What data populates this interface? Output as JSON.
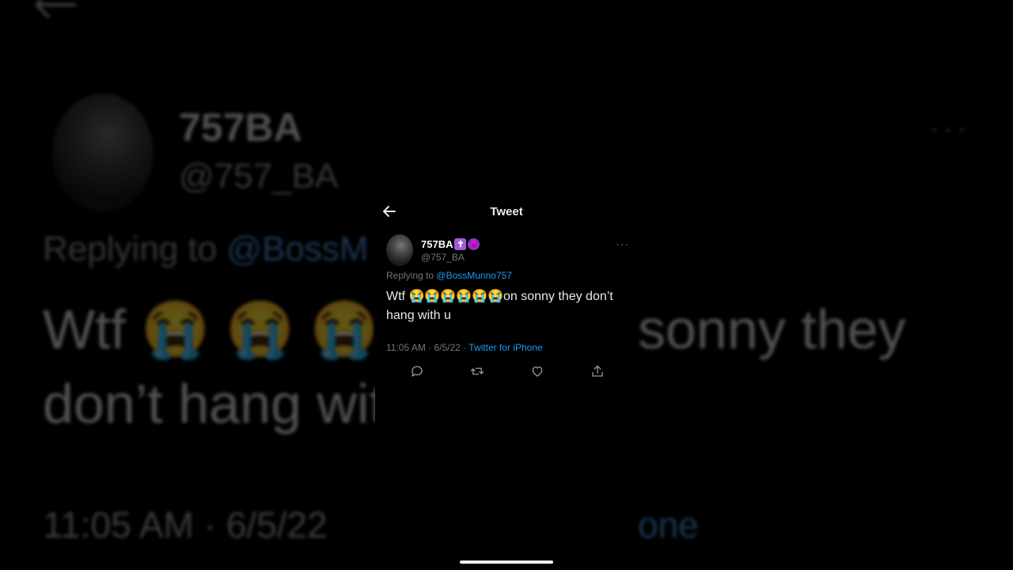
{
  "header": {
    "title": "Tweet"
  },
  "tweet": {
    "author_name": "757BA",
    "author_badges": [
      "✝",
      "😈"
    ],
    "handle": "@757_BA",
    "replying_prefix": "Replying to",
    "replying_to": "@BossMunno757",
    "text": "Wtf 😭😭😭😭😭😭on sonny they don’t hang with u",
    "timestamp": "11:05 AM · 6/5/22 · ",
    "source": "Twitter for iPhone"
  },
  "actions": [
    "reply-icon",
    "retweet-icon",
    "like-icon",
    "share-icon"
  ],
  "background_blur": {
    "name": "757BA",
    "handle": "@757_BA",
    "replying_prefix": "Replying to",
    "replying_to": "@BossM",
    "line1": "Wtf 😭 😭 😭 😭",
    "line2": "don’t hang wit",
    "right_text": "sonny they",
    "time": "11:05 AM · 6/5/22",
    "right_time": "one"
  },
  "colors": {
    "accent": "#1d9bf0",
    "background": "#000000",
    "secondary": "#71767b"
  }
}
